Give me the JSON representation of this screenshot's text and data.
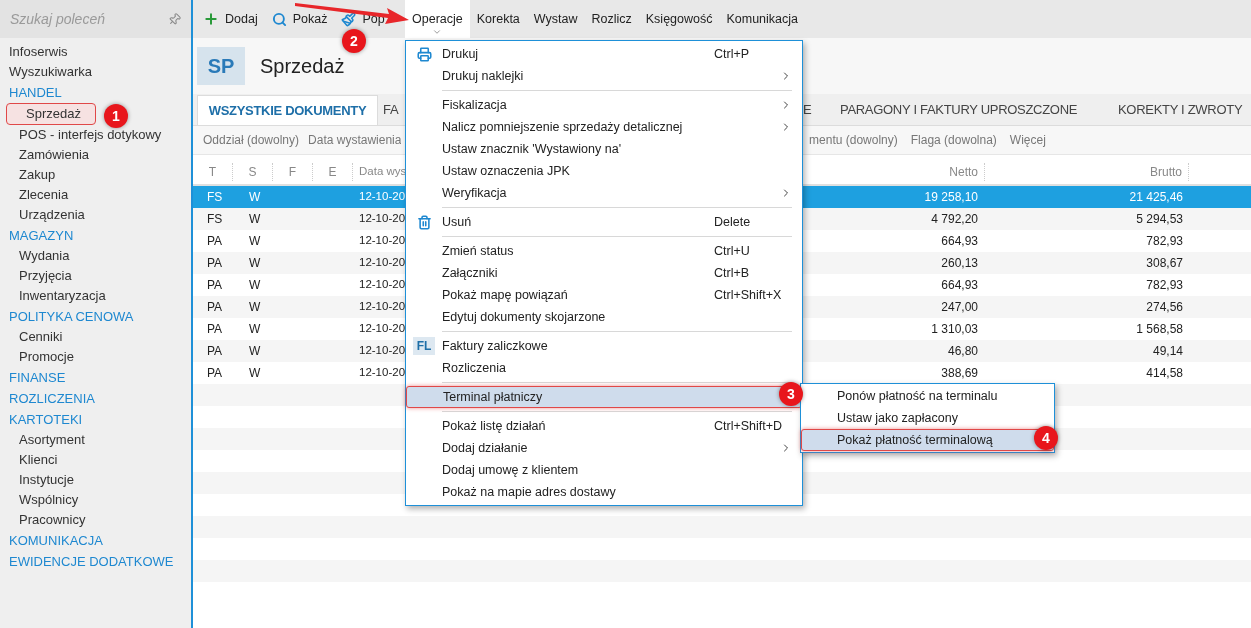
{
  "sidebar": {
    "search": {
      "placeholder": "Szukaj poleceń"
    },
    "items": [
      {
        "kind": "link",
        "label": "Infoserwis"
      },
      {
        "kind": "link",
        "label": "Wyszukiwarka"
      },
      {
        "kind": "section",
        "label": "HANDEL",
        "children": [
          {
            "label": "Sprzedaż",
            "selected": true
          },
          {
            "label": "POS - interfejs dotykowy",
            "selected": false
          },
          {
            "label": "Zamówienia",
            "selected": false
          },
          {
            "label": "Zakup",
            "selected": false
          },
          {
            "label": "Zlecenia",
            "selected": false
          },
          {
            "label": "Urządzenia",
            "selected": false
          }
        ]
      },
      {
        "kind": "section",
        "label": "MAGAZYN",
        "children": [
          {
            "label": "Wydania",
            "selected": false
          },
          {
            "label": "Przyjęcia",
            "selected": false
          },
          {
            "label": "Inwentaryzacja",
            "selected": false
          }
        ]
      },
      {
        "kind": "section",
        "label": "POLITYKA CENOWA",
        "children": [
          {
            "label": "Cenniki",
            "selected": false
          },
          {
            "label": "Promocje",
            "selected": false
          }
        ]
      },
      {
        "kind": "section",
        "label": "FINANSE"
      },
      {
        "kind": "section",
        "label": "ROZLICZENIA"
      },
      {
        "kind": "section",
        "label": "KARTOTEKI",
        "children": [
          {
            "label": "Asortyment",
            "selected": false
          },
          {
            "label": "Klienci",
            "selected": false
          },
          {
            "label": "Instytucje",
            "selected": false
          },
          {
            "label": "Wspólnicy",
            "selected": false
          },
          {
            "label": "Pracownicy",
            "selected": false
          }
        ]
      },
      {
        "kind": "section",
        "label": "KOMUNIKACJA"
      },
      {
        "kind": "section",
        "label": "EWIDENCJE DODATKOWE"
      }
    ]
  },
  "toolbar": {
    "actions": [
      {
        "label": "Dodaj"
      },
      {
        "label": "Pokaż"
      },
      {
        "label": "Pop"
      }
    ],
    "menus": [
      {
        "label": "Operacje",
        "selected": true
      },
      {
        "label": "Korekta",
        "selected": false
      },
      {
        "label": "Wystaw",
        "selected": false
      },
      {
        "label": "Rozlicz",
        "selected": false
      },
      {
        "label": "Księgowość",
        "selected": false
      },
      {
        "label": "Komunikacja",
        "selected": false
      }
    ]
  },
  "header": {
    "badge": "SP",
    "title": "Sprzedaż"
  },
  "tabs": [
    {
      "label": "WSZYSTKIE DOKUMENTY",
      "selected": true
    },
    {
      "label": "FA",
      "selected": false
    },
    {
      "label": "E",
      "selected": false
    },
    {
      "label": "PARAGONY I FAKTURY UPROSZCZONE",
      "selected": false
    },
    {
      "label": "KOREKTY I ZWROTY",
      "selected": false
    }
  ],
  "filters": [
    "Oddział (dowolny)",
    "Data wystawienia",
    "mentu (dowolny)",
    "Flaga (dowolna)",
    "Więcej"
  ],
  "table": {
    "columns": [
      "T",
      "S",
      "F",
      "E",
      "Data wys",
      "Netto",
      "Brutto"
    ],
    "rows": [
      {
        "t": "FS",
        "s": "W",
        "date": "12-10-20",
        "netto": "19 258,10",
        "brutto": "21 425,46",
        "selected": true
      },
      {
        "t": "FS",
        "s": "W",
        "date": "12-10-20",
        "netto": "4 792,20",
        "brutto": "5 294,53",
        "selected": false
      },
      {
        "t": "PA",
        "s": "W",
        "date": "12-10-20",
        "netto": "664,93",
        "brutto": "782,93",
        "selected": false
      },
      {
        "t": "PA",
        "s": "W",
        "date": "12-10-20",
        "netto": "260,13",
        "brutto": "308,67",
        "selected": false
      },
      {
        "t": "PA",
        "s": "W",
        "date": "12-10-20",
        "netto": "664,93",
        "brutto": "782,93",
        "selected": false
      },
      {
        "t": "PA",
        "s": "W",
        "date": "12-10-20",
        "netto": "247,00",
        "brutto": "274,56",
        "selected": false
      },
      {
        "t": "PA",
        "s": "W",
        "date": "12-10-20",
        "netto": "1 310,03",
        "brutto": "1 568,58",
        "selected": false
      },
      {
        "t": "PA",
        "s": "W",
        "date": "12-10-20",
        "netto": "46,80",
        "brutto": "49,14",
        "selected": false
      },
      {
        "t": "PA",
        "s": "W",
        "date": "12-10-20",
        "netto": "388,69",
        "brutto": "414,58",
        "selected": false
      }
    ]
  },
  "menu": {
    "items": [
      {
        "kind": "item",
        "label": "Drukuj",
        "shortcut": "Ctrl+P",
        "submenu": false,
        "selected": false
      },
      {
        "kind": "item",
        "label": "Drukuj naklejki",
        "submenu": true,
        "selected": false
      },
      {
        "kind": "separator"
      },
      {
        "kind": "item",
        "label": "Fiskalizacja",
        "submenu": true,
        "selected": false
      },
      {
        "kind": "item",
        "label": "Nalicz pomniejszenie sprzedaży detalicznej",
        "submenu": true,
        "selected": false
      },
      {
        "kind": "item",
        "label": "Ustaw znacznik 'Wystawiony na'",
        "submenu": false,
        "selected": false
      },
      {
        "kind": "item",
        "label": "Ustaw oznaczenia JPK",
        "submenu": false,
        "selected": false
      },
      {
        "kind": "item",
        "label": "Weryfikacja",
        "submenu": true,
        "selected": false
      },
      {
        "kind": "separator"
      },
      {
        "kind": "item",
        "label": "Usuń",
        "shortcut": "Delete",
        "submenu": false,
        "selected": false
      },
      {
        "kind": "separator"
      },
      {
        "kind": "item",
        "label": "Zmień status",
        "shortcut": "Ctrl+U",
        "submenu": false,
        "selected": false
      },
      {
        "kind": "item",
        "label": "Załączniki",
        "shortcut": "Ctrl+B",
        "submenu": false,
        "selected": false
      },
      {
        "kind": "item",
        "label": "Pokaż mapę powiązań",
        "shortcut": "Ctrl+Shift+X",
        "submenu": false,
        "selected": false
      },
      {
        "kind": "item",
        "label": "Edytuj dokumenty skojarzone",
        "submenu": false,
        "selected": false
      },
      {
        "kind": "separator"
      },
      {
        "kind": "item",
        "badge": "FL",
        "label": "Faktury zaliczkowe",
        "submenu": false,
        "selected": false
      },
      {
        "kind": "item",
        "label": "Rozliczenia",
        "submenu": false,
        "selected": false
      },
      {
        "kind": "separator"
      },
      {
        "kind": "item",
        "label": "Terminal płatniczy",
        "submenu": false,
        "selected": true
      },
      {
        "kind": "separator"
      },
      {
        "kind": "item",
        "label": "Pokaż listę działań",
        "shortcut": "Ctrl+Shift+D",
        "submenu": false,
        "selected": false
      },
      {
        "kind": "item",
        "label": "Dodaj działanie",
        "submenu": true,
        "selected": false
      },
      {
        "kind": "item",
        "label": "Dodaj umowę z klientem",
        "submenu": false,
        "selected": false
      },
      {
        "kind": "item",
        "label": "Pokaż na mapie adres dostawy",
        "submenu": false,
        "selected": false
      }
    ]
  },
  "submenu": {
    "items": [
      {
        "label": "Ponów płatność na terminalu",
        "selected": false
      },
      {
        "label": "Ustaw jako zapłacony",
        "selected": false
      },
      {
        "label": "Pokaż płatność terminalową",
        "selected": true
      }
    ]
  },
  "annotations": [
    "1",
    "2",
    "3",
    "4"
  ]
}
